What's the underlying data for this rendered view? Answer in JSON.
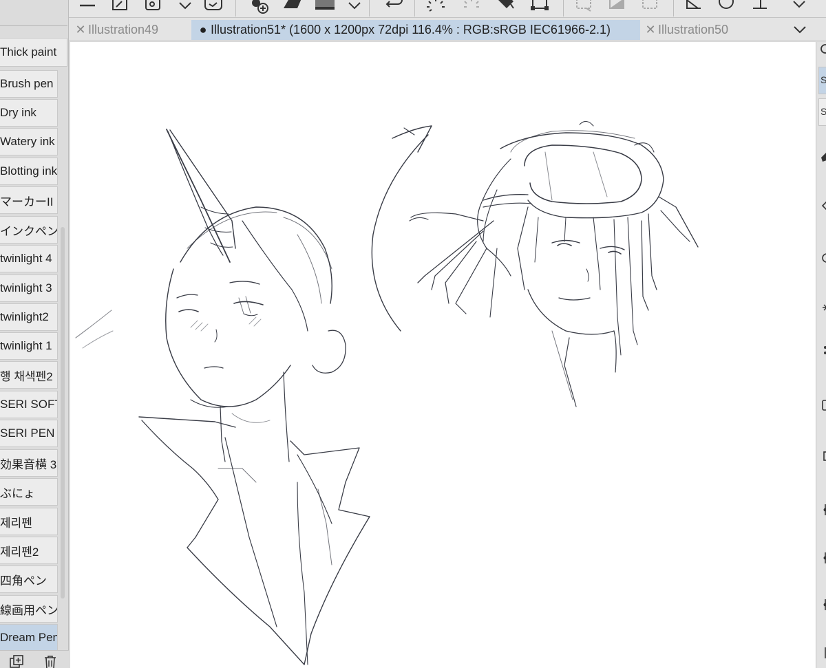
{
  "tabs": [
    {
      "label": "Illustration49",
      "icon": "close-icon",
      "active": false
    },
    {
      "label": "Illustration51* (1600 x 1200px 72dpi 116.4% : RGB:sRGB IEC61966-2.1)",
      "icon": "unsaved-dot-icon",
      "active": true
    },
    {
      "label": "Illustration50",
      "icon": "close-icon",
      "active": false
    }
  ],
  "subtools": [
    {
      "label": "Thick paint"
    },
    {
      "label": "Brush pen"
    },
    {
      "label": "Dry ink"
    },
    {
      "label": "Watery ink"
    },
    {
      "label": "Blotting ink"
    },
    {
      "label": "マーカーII"
    },
    {
      "label": "インクペン"
    },
    {
      "label": "twinlight 4"
    },
    {
      "label": "twinlight 3"
    },
    {
      "label": "twinlight2"
    },
    {
      "label": "twinlight 1"
    },
    {
      "label": "행 채색펜2"
    },
    {
      "label": "SERI SOFT"
    },
    {
      "label": "SERI PEN"
    },
    {
      "label": "効果音横 3"
    },
    {
      "label": "ぶにょ"
    },
    {
      "label": "제리펜"
    },
    {
      "label": "제리펜2"
    },
    {
      "label": "四角ペン"
    },
    {
      "label": "線画用ペン"
    },
    {
      "label": "Dream Pencil",
      "selected": true
    }
  ],
  "right_strip": {
    "btn1": "S",
    "btn2": "S"
  },
  "colors": {
    "selected": "#c3d4e6",
    "panel": "#dcdcdc",
    "canvas": "#ffffff"
  }
}
